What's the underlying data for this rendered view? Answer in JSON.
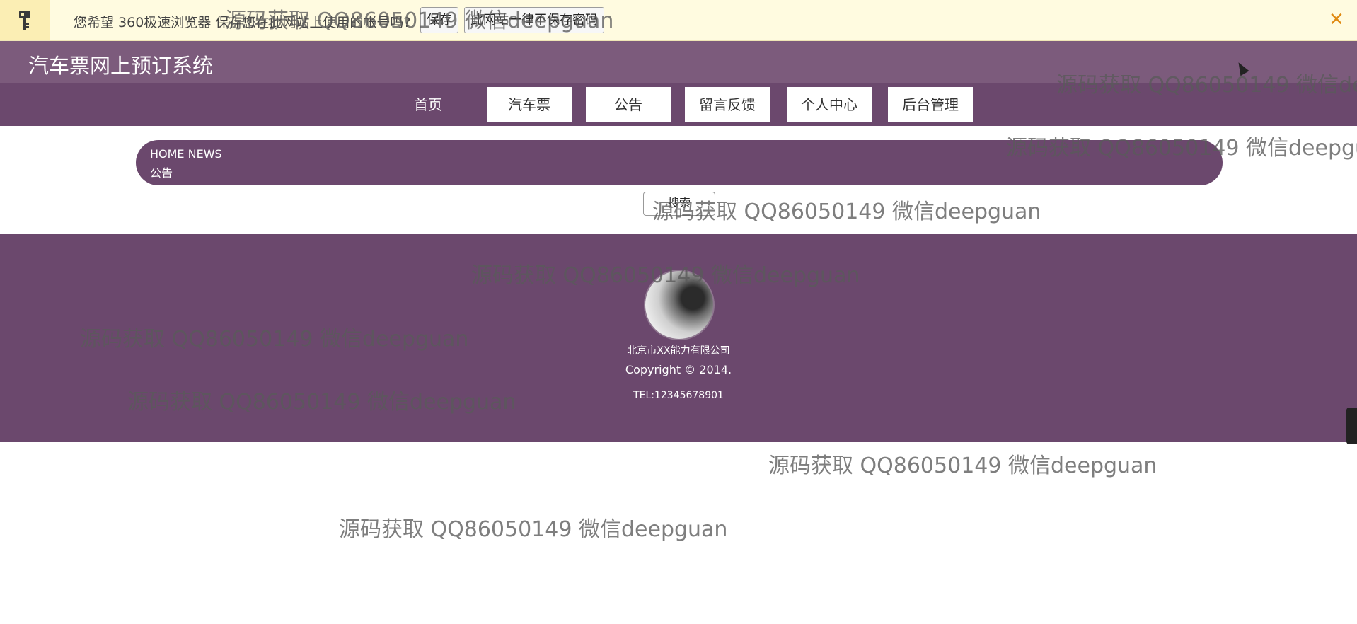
{
  "password_bar": {
    "message": "您希望 360极速浏览器 保存您在此网站上使用的帐号吗?",
    "save_button": "保存",
    "never_button": "此网站一律不保存密码",
    "close_glyph": "✕",
    "icon": "key-icon"
  },
  "header": {
    "title": "汽车票网上预订系统"
  },
  "nav": {
    "items": [
      {
        "label": "首页"
      },
      {
        "label": "汽车票"
      },
      {
        "label": "公告"
      },
      {
        "label": "留言反馈"
      },
      {
        "label": "个人中心"
      },
      {
        "label": "后台管理"
      }
    ]
  },
  "breadcrumb": {
    "en": "HOME NEWS",
    "zh": "公告"
  },
  "search_button": {
    "label": "搜索"
  },
  "footer": {
    "company": "北京市XX能力有限公司",
    "copyright": "Copyright © 2014.",
    "tel": "TEL:12345678901"
  },
  "watermark": {
    "text": "源码获取 QQ86050149 微信deepguan"
  },
  "colors": {
    "nav_purple": "#6b486d",
    "header_purple": "#7c5b7c",
    "notice_bg": "#fffbe0",
    "close_orange": "#e08a12"
  }
}
